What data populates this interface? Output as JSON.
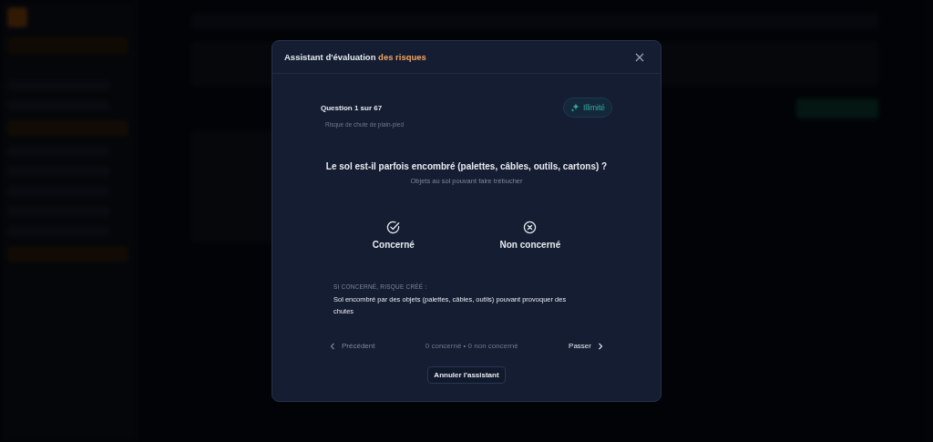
{
  "dialog": {
    "title": "Assistant d'évaluation",
    "title_accent": "des risques",
    "progress": "Question 1 sur 67",
    "badge": "Illimité",
    "category": "Risque de chute de plain-pied",
    "question": "Le sol est-il parfois encombré (palettes, câbles, outils, cartons) ?",
    "hint": "Objets au sol pouvant faire trébucher",
    "choices": [
      {
        "kind": "check",
        "label": "Concerné",
        "selected": false
      },
      {
        "kind": "cross",
        "label": "Non concerné",
        "selected": false
      }
    ],
    "risk_label": "SI CONCERNÉ, RISQUE CRÉÉ :",
    "risk_text": "Sol encombré par des objets (palettes, câbles, outils) pouvant provoquer des chutes",
    "previous": {
      "label": "Précédent",
      "disabled": true
    },
    "tally": "0 concerné • 0 non concerné",
    "next": {
      "label": "Passer",
      "disabled": false
    },
    "cancel": "Annuler l'assistant"
  }
}
